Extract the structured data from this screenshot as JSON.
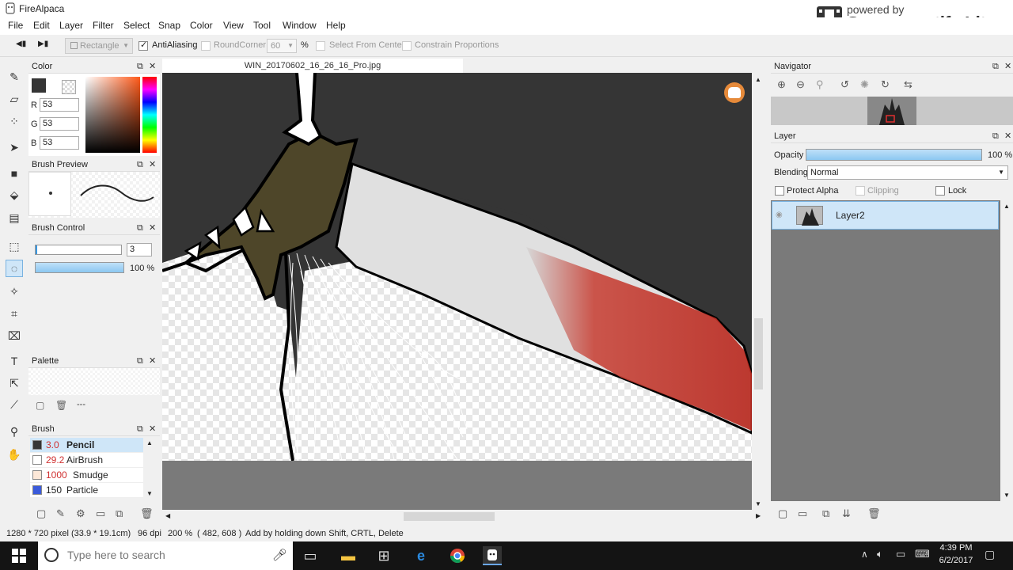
{
  "app": {
    "title": "FireAlpaca"
  },
  "brand": {
    "small": "powered by",
    "big": "Screencastify Lite"
  },
  "menu": [
    "File",
    "Edit",
    "Layer",
    "Filter",
    "Select",
    "Snap",
    "Color",
    "View",
    "Tool",
    "Window",
    "Help"
  ],
  "tool_options": {
    "shape": "Rectangle",
    "antialiasing": "AntiAliasing",
    "roundcorner": "RoundCorner",
    "roundcorner_value": "60",
    "percent": "%",
    "select_from_center": "Select From Center",
    "constrain": "Constrain Proportions"
  },
  "canvas": {
    "filename": "WIN_20170602_16_26_16_Pro.jpg"
  },
  "color_panel": {
    "title": "Color",
    "r_label": "R",
    "g_label": "G",
    "b_label": "B",
    "r": "53",
    "g": "53",
    "b": "53",
    "current": "#353535",
    "accent": "#c0392b"
  },
  "brush_preview": {
    "title": "Brush Preview"
  },
  "brush_control": {
    "title": "Brush Control",
    "size": "3",
    "opacity": "100 %",
    "opacity_fraction": 1.0
  },
  "palette": {
    "title": "Palette",
    "dash": "---"
  },
  "brush": {
    "title": "Brush",
    "items": [
      {
        "size": "3.0",
        "name": "Pencil",
        "color": "#353535"
      },
      {
        "size": "29.2",
        "name": "AirBrush",
        "color": "#ffffff"
      },
      {
        "size": "1000",
        "name": "Smudge",
        "color": "#fde8d8"
      },
      {
        "size": "150",
        "name": "Particle",
        "color": "#3b5bdb"
      }
    ]
  },
  "navigator": {
    "title": "Navigator"
  },
  "layer_panel": {
    "title": "Layer",
    "opacity_label": "Opacity",
    "opacity_value": "100 %",
    "opacity_fraction": 1.0,
    "blending_label": "Blending",
    "blending_value": "Normal",
    "protect_alpha": "Protect Alpha",
    "clipping": "Clipping",
    "lock": "Lock",
    "layers": [
      {
        "name": "Layer2"
      }
    ]
  },
  "status": {
    "size": "1280 * 720 pixel",
    "cm": "(33.9 * 19.1cm)",
    "dpi": "96 dpi",
    "zoom": "200 %",
    "coords": "( 482, 608 )",
    "hint": "Add by holding down Shift, CRTL, Delete"
  },
  "taskbar": {
    "search_placeholder": "Type here to search",
    "time": "4:39 PM",
    "date": "6/2/2017"
  }
}
